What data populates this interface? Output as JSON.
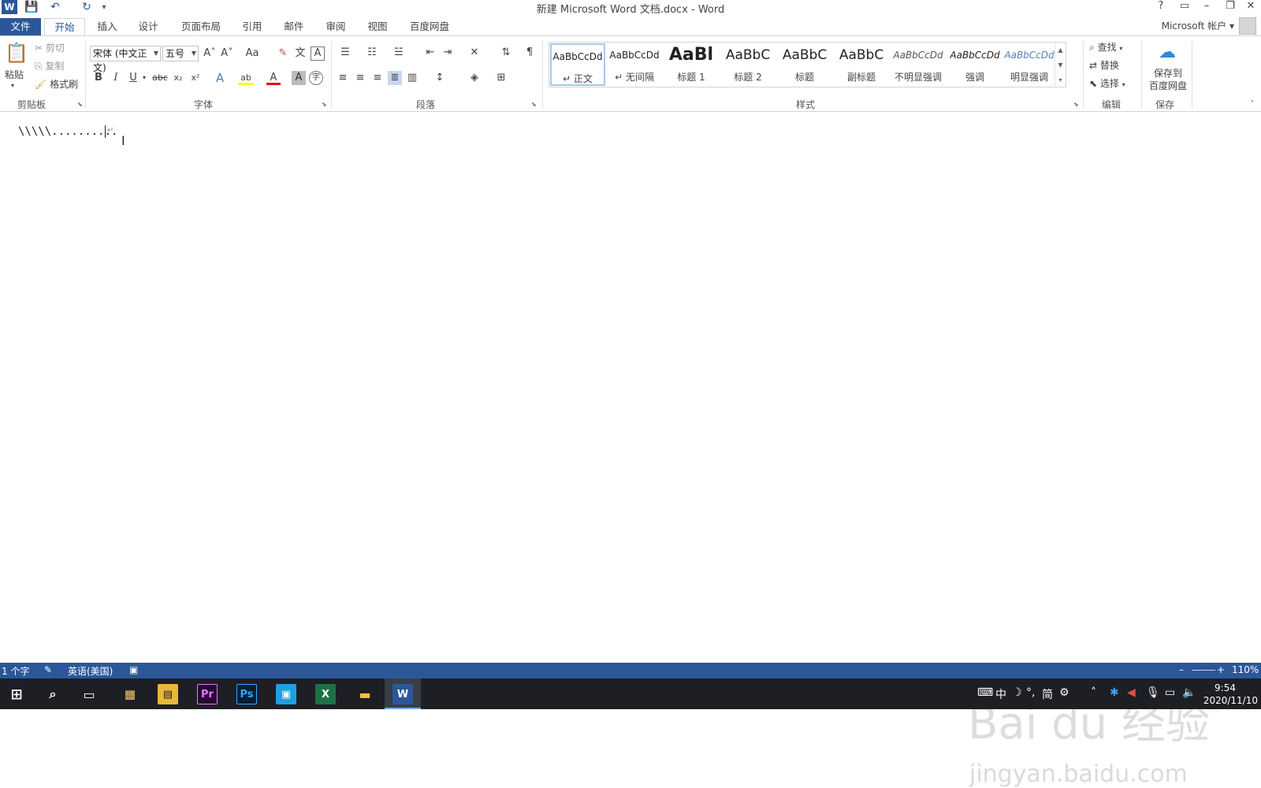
{
  "window": {
    "title": "新建 Microsoft Word 文档.docx - Word",
    "help": "?",
    "ribbon_display": "▭",
    "minimize": "–",
    "restore": "❐",
    "close": "✕"
  },
  "quick_access": {
    "app_icon": "W",
    "save": "💾",
    "undo": "↶",
    "redo": "↻",
    "customize": "▾"
  },
  "tabs": [
    "文件",
    "开始",
    "插入",
    "设计",
    "页面布局",
    "引用",
    "邮件",
    "审阅",
    "视图",
    "百度网盘"
  ],
  "active_tab": "开始",
  "account": "Microsoft 帐户 ▾",
  "clipboard": {
    "label": "剪贴板",
    "paste": "粘贴",
    "cut": "剪切",
    "copy": "复制",
    "format_painter": "格式刷"
  },
  "font": {
    "label": "字体",
    "font_name": "宋体 (中文正文)",
    "font_size": "五号",
    "grow": "A˄",
    "shrink": "A˅",
    "change_case": "Aa",
    "bold": "B",
    "italic": "I",
    "underline": "U",
    "strikethrough": "abc",
    "subscript": "x₂",
    "superscript": "x²",
    "text_effects": "A",
    "highlight": "ab",
    "font_color": "A",
    "char_shading": "A",
    "enclose": "字"
  },
  "paragraph": {
    "label": "段落"
  },
  "styles": {
    "label": "样式",
    "items": [
      {
        "sample": "AaBbCcDd",
        "name": "↵ 正文"
      },
      {
        "sample": "AaBbCcDd",
        "name": "↵ 无间隔"
      },
      {
        "sample": "AaBl",
        "name": "标题 1"
      },
      {
        "sample": "AaBbC",
        "name": "标题 2"
      },
      {
        "sample": "AaBbC",
        "name": "标题"
      },
      {
        "sample": "AaBbC",
        "name": "副标题"
      },
      {
        "sample": "AaBbCcDd",
        "name": "不明显强调"
      },
      {
        "sample": "AaBbCcDd",
        "name": "强调"
      },
      {
        "sample": "AaBbCcDd",
        "name": "明显强调"
      }
    ]
  },
  "editing": {
    "label": "编辑",
    "find": "查找",
    "replace": "替换",
    "select": "选择"
  },
  "save_group": {
    "label": "保存",
    "save_to": "保存到",
    "baidu": "百度网盘"
  },
  "document": {
    "text": "\\\\\\\\\\..........",
    "paragraph_mark": "↵"
  },
  "watermark": {
    "brand": "Bai du 经验",
    "url": "jingyan.baidu.com"
  },
  "status": {
    "word_count": "1 个字",
    "language": "英语(美国)",
    "zoom": "110%"
  },
  "taskbar": {
    "apps": [
      "Pr",
      "Ps",
      "X",
      "W"
    ],
    "ime": "中",
    "ime_mode": "简",
    "time": "9:54",
    "date": "2020/11/10"
  },
  "colors": {
    "accent": "#2b579a",
    "taskbar": "#1d1f24"
  }
}
